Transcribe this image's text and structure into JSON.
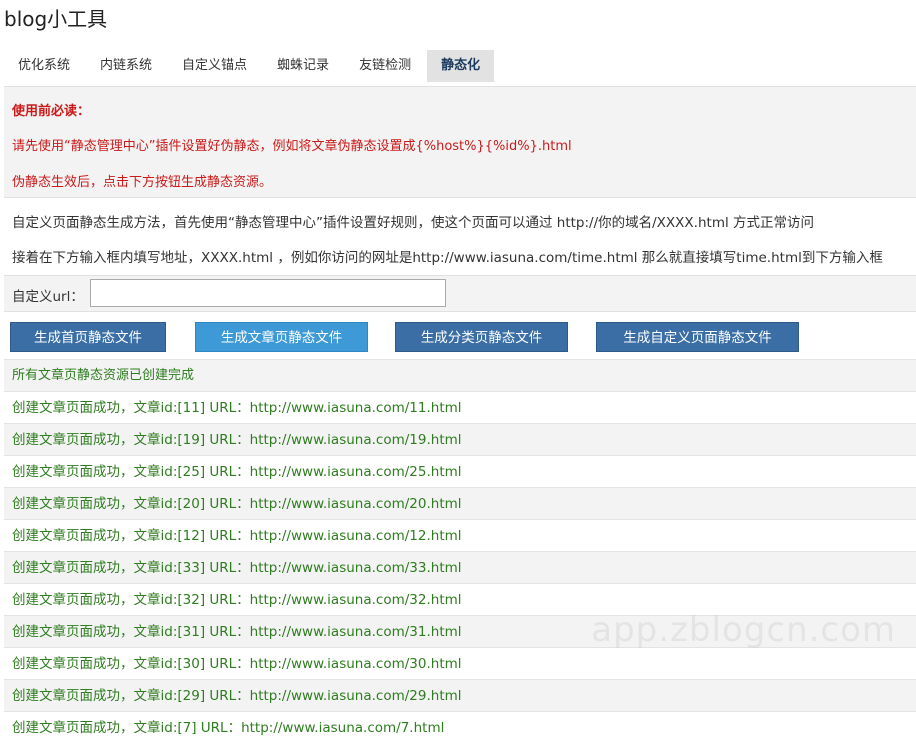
{
  "app": {
    "title": "blog小工具"
  },
  "tabs": [
    {
      "label": "优化系统",
      "active": false
    },
    {
      "label": "内链系统",
      "active": false
    },
    {
      "label": "自定义锚点",
      "active": false
    },
    {
      "label": "蜘蛛记录",
      "active": false
    },
    {
      "label": "友链检测",
      "active": false
    },
    {
      "label": "静态化",
      "active": true
    }
  ],
  "notice": {
    "heading": "使用前必读：",
    "line1": "请先使用“静态管理中心”插件设置好伪静态，例如将文章伪静态设置成{%host%}{%id%}.html",
    "line2": "伪静态生效后，点击下方按钮生成静态资源。"
  },
  "info": {
    "line1": "自定义页面静态生成方法，首先使用“静态管理中心”插件设置好规则，使这个页面可以通过 http://你的域名/XXXX.html 方式正常访问",
    "line2": "接着在下方输入框内填写地址，XXXX.html ，例如你访问的网址是http://www.iasuna.com/time.html 那么就直接填写time.html到下方输入框"
  },
  "custom_url": {
    "label": "自定义url：",
    "value": "",
    "placeholder": ""
  },
  "buttons": {
    "home": "生成首页静态文件",
    "article": "生成文章页静态文件",
    "category": "生成分类页静态文件",
    "custom": "生成自定义页面静态文件"
  },
  "results": {
    "status": "所有文章页静态资源已创建完成",
    "items": [
      "创建文章页面成功，文章id:[11] URL：http://www.iasuna.com/11.html",
      "创建文章页面成功，文章id:[19] URL：http://www.iasuna.com/19.html",
      "创建文章页面成功，文章id:[25] URL：http://www.iasuna.com/25.html",
      "创建文章页面成功，文章id:[20] URL：http://www.iasuna.com/20.html",
      "创建文章页面成功，文章id:[12] URL：http://www.iasuna.com/12.html",
      "创建文章页面成功，文章id:[33] URL：http://www.iasuna.com/33.html",
      "创建文章页面成功，文章id:[32] URL：http://www.iasuna.com/32.html",
      "创建文章页面成功，文章id:[31] URL：http://www.iasuna.com/31.html",
      "创建文章页面成功，文章id:[30] URL：http://www.iasuna.com/30.html",
      "创建文章页面成功，文章id:[29] URL：http://www.iasuna.com/29.html",
      "创建文章页面成功，文章id:[7] URL：http://www.iasuna.com/7.html"
    ]
  },
  "watermark": "app.zblogcn.com",
  "colors": {
    "notice_text": "#cc1a1a",
    "result_text": "#2e7d1f",
    "button_bg": "#3a6ea5",
    "button_hover_bg": "#3e9ad6"
  }
}
